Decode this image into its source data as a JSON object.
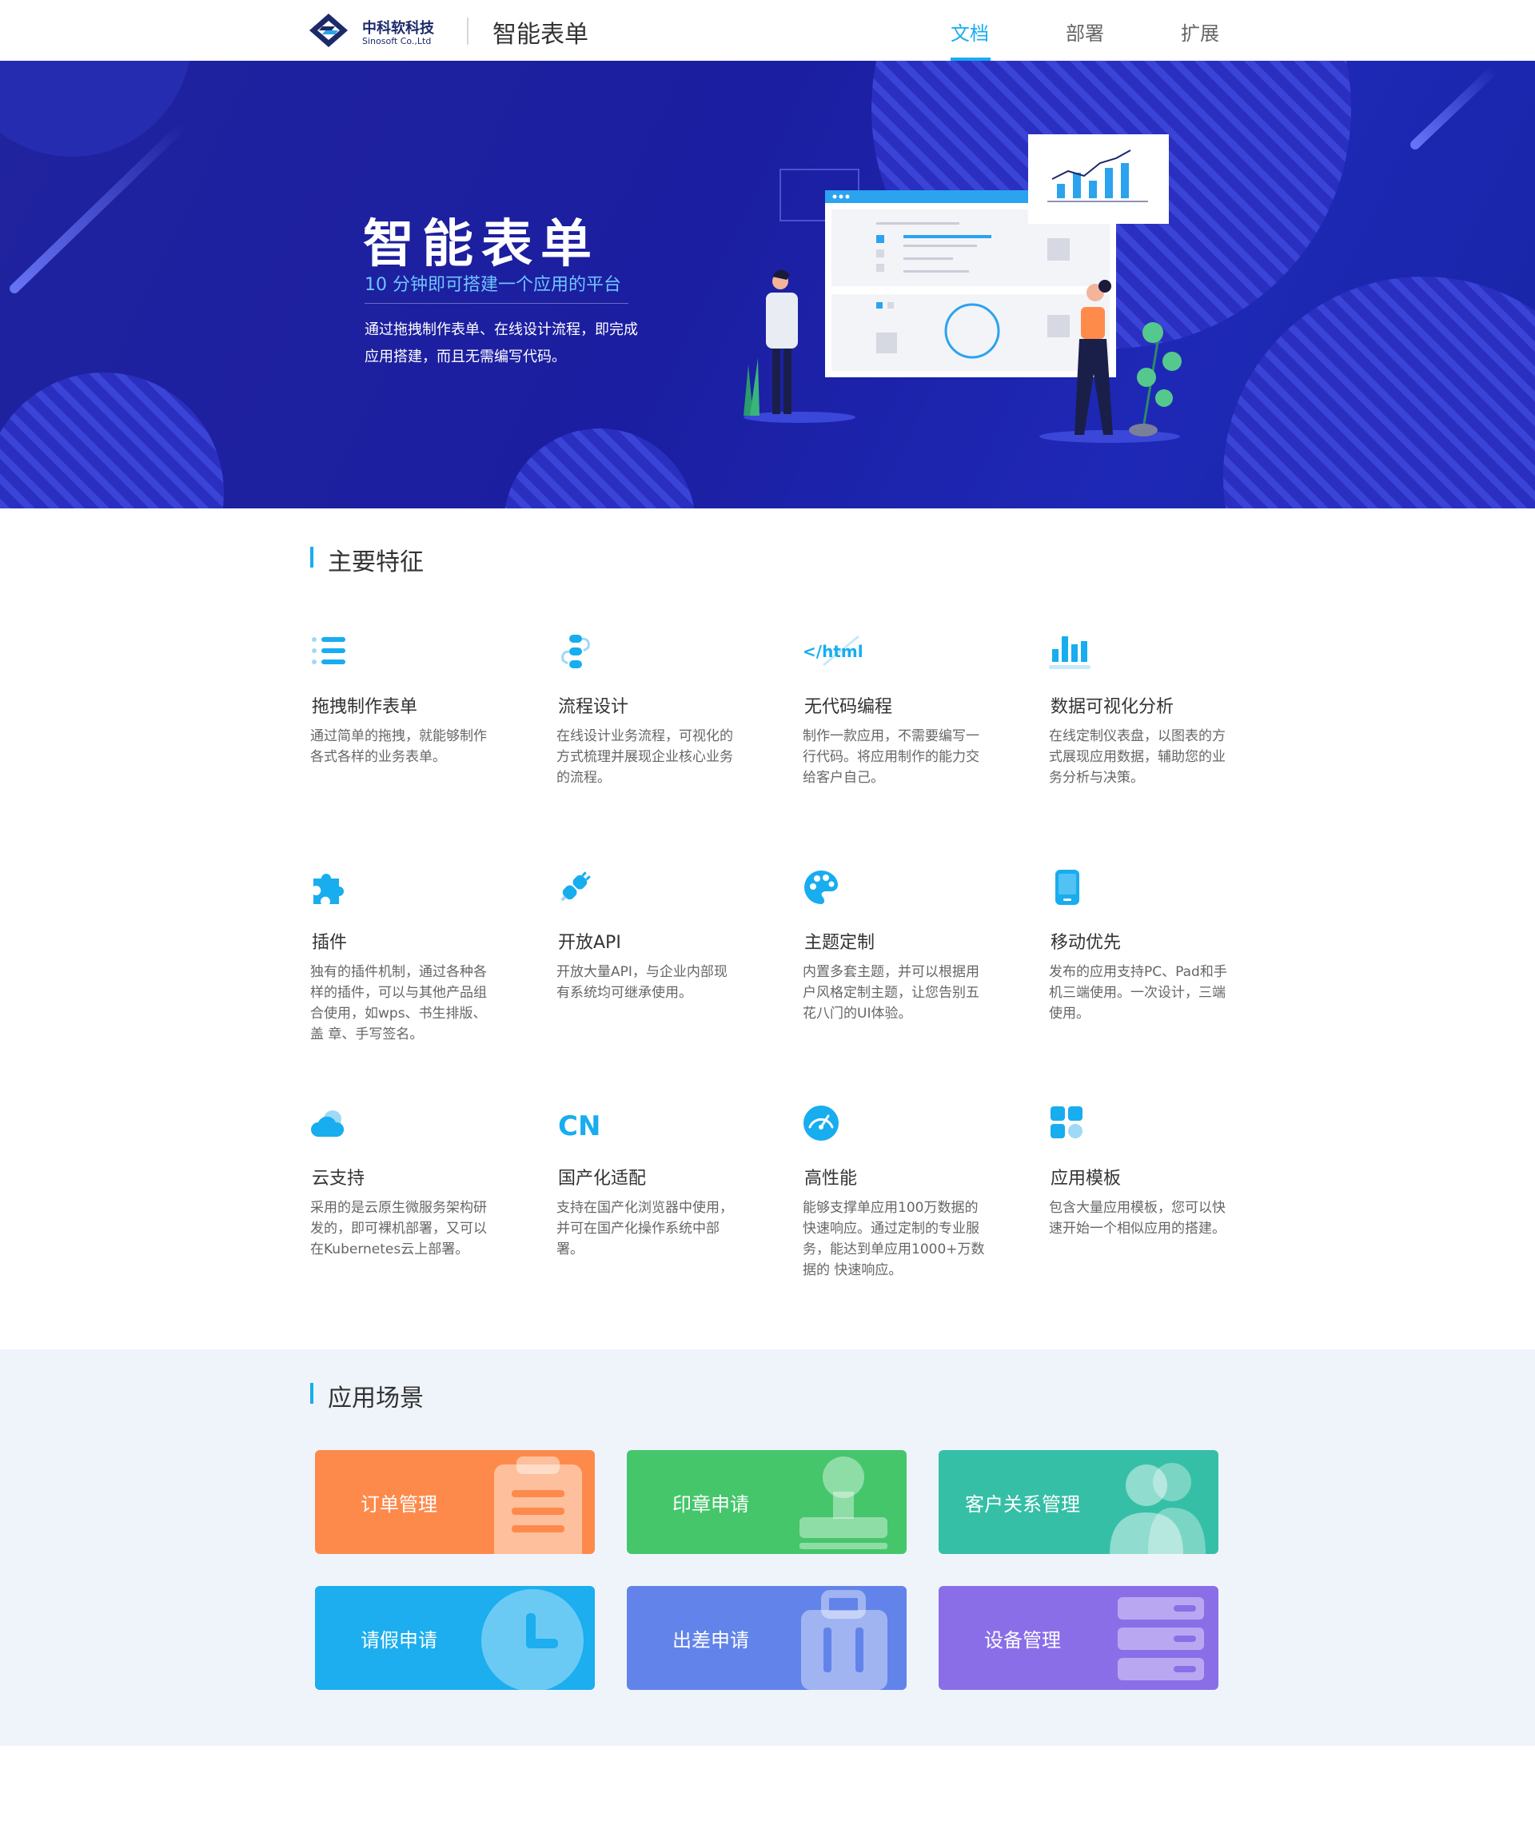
{
  "header": {
    "logo_cn": "中科软科技",
    "logo_en": "Sinosoft Co.,Ltd",
    "app_title": "智能表单",
    "nav": [
      {
        "label": "文档",
        "active": true
      },
      {
        "label": "部署",
        "active": false
      },
      {
        "label": "扩展",
        "active": false
      }
    ]
  },
  "hero": {
    "title": "智能表单",
    "subtitle": "10 分钟即可搭建一个应用的平台",
    "description": "通过拖拽制作表单、在线设计流程，即完成应用搭建，而且无需编写代码。"
  },
  "features_section": {
    "title": "主要特征",
    "items": [
      {
        "icon": "list-icon",
        "name": "拖拽制作表单",
        "desc": "通过简单的拖拽，就能够制作各式各样的业务表单。"
      },
      {
        "icon": "flow-icon",
        "name": "流程设计",
        "desc": "在线设计业务流程，可视化的方式梳理并展现企业核心业务的流程。"
      },
      {
        "icon": "html-code-icon",
        "name": "无代码编程",
        "desc": "制作一款应用，不需要编写一行代码。将应用制作的能力交给客户自己。"
      },
      {
        "icon": "bar-chart-icon",
        "name": "数据可视化分析",
        "desc": "在线定制仪表盘，以图表的方式展现应用数据，辅助您的业务分析与决策。"
      },
      {
        "icon": "puzzle-icon",
        "name": "插件",
        "desc": "独有的插件机制，通过各种各样的插件，可以与其他产品组合使用，如wps、书生排版、盖 章、手写签名。"
      },
      {
        "icon": "plug-icon",
        "name": "开放API",
        "desc": "开放大量API，与企业内部现有系统均可继承使用。"
      },
      {
        "icon": "palette-icon",
        "name": "主题定制",
        "desc": "内置多套主题，并可以根据用户风格定制主题，让您告别五花八门的UI体验。"
      },
      {
        "icon": "mobile-icon",
        "name": "移动优先",
        "desc": "发布的应用支持PC、Pad和手机三端使用。一次设计，三端使用。"
      },
      {
        "icon": "cloud-icon",
        "name": "云支持",
        "desc": "采用的是云原生微服务架构研发的，即可裸机部署，又可以在Kubernetes云上部署。"
      },
      {
        "icon": "cn-icon",
        "name": "国产化适配",
        "desc": "支持在国产化浏览器中使用，并可在国产化操作系统中部署。"
      },
      {
        "icon": "speedometer-icon",
        "name": "高性能",
        "desc": "能够支撑单应用100万数据的快速响应。通过定制的专业服务，能达到单应用1000+万数据的 快速响应。"
      },
      {
        "icon": "grid-apps-icon",
        "name": "应用模板",
        "desc": "包含大量应用模板，您可以快速开始一个相似应用的搭建。"
      }
    ]
  },
  "scenarios_section": {
    "title": "应用场景",
    "cards": [
      {
        "label": "订单管理",
        "icon": "clipboard-icon",
        "color": "#fd8a4b"
      },
      {
        "label": "印章申请",
        "icon": "stamp-icon",
        "color": "#45c66b"
      },
      {
        "label": "客户关系管理",
        "icon": "users-icon",
        "color": "#35bfa6"
      },
      {
        "label": "请假申请",
        "icon": "clock-icon",
        "color": "#1caeee"
      },
      {
        "label": "出差申请",
        "icon": "suitcase-icon",
        "color": "#6283e9"
      },
      {
        "label": "设备管理",
        "icon": "server-icon",
        "color": "#8a6ee8"
      }
    ]
  },
  "colors": {
    "accent": "#18adef",
    "title_text": "#333333",
    "body_text": "#666666",
    "hero_bg": "#1e24a6",
    "scenarios_bg": "#eff4fb"
  }
}
